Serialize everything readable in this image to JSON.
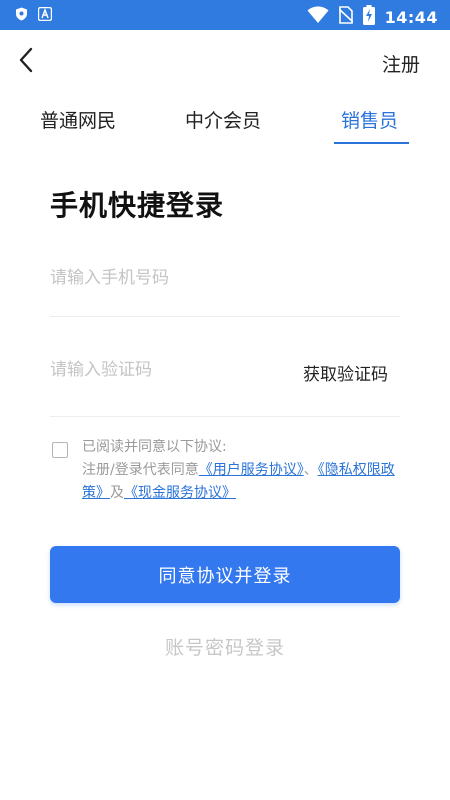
{
  "status_bar": {
    "time": "14:44",
    "bg_color": "#2f7be0",
    "left_icons": [
      "shield-icon",
      "text-a-icon"
    ],
    "right_icons": [
      "wifi-icon",
      "no-sim-icon",
      "battery-charging-icon"
    ]
  },
  "header": {
    "back_icon": "chevron-left-icon",
    "register_label": "注册"
  },
  "tabs": [
    {
      "label": "普通网民",
      "active": false
    },
    {
      "label": "中介会员",
      "active": false
    },
    {
      "label": "销售员",
      "active": true
    }
  ],
  "accent_color": "#2a73d9",
  "form": {
    "title": "手机快捷登录",
    "phone_placeholder": "请输入手机号码",
    "phone_value": "",
    "code_placeholder": "请输入验证码",
    "code_value": "",
    "get_code_label": "获取验证码"
  },
  "agreement": {
    "checked": false,
    "line1": "已阅读并同意以下协议:",
    "prefix": "注册/登录代表同意",
    "link_user_service": "《用户服务协议》",
    "sep1": "、",
    "link_privacy": "《隐私权限政策》",
    "sep2": "及",
    "link_cash_service": "《现金服务协议》"
  },
  "login_button_label": "同意协议并登录",
  "login_button_color": "#3478f0",
  "account_login_label": "账号密码登录"
}
